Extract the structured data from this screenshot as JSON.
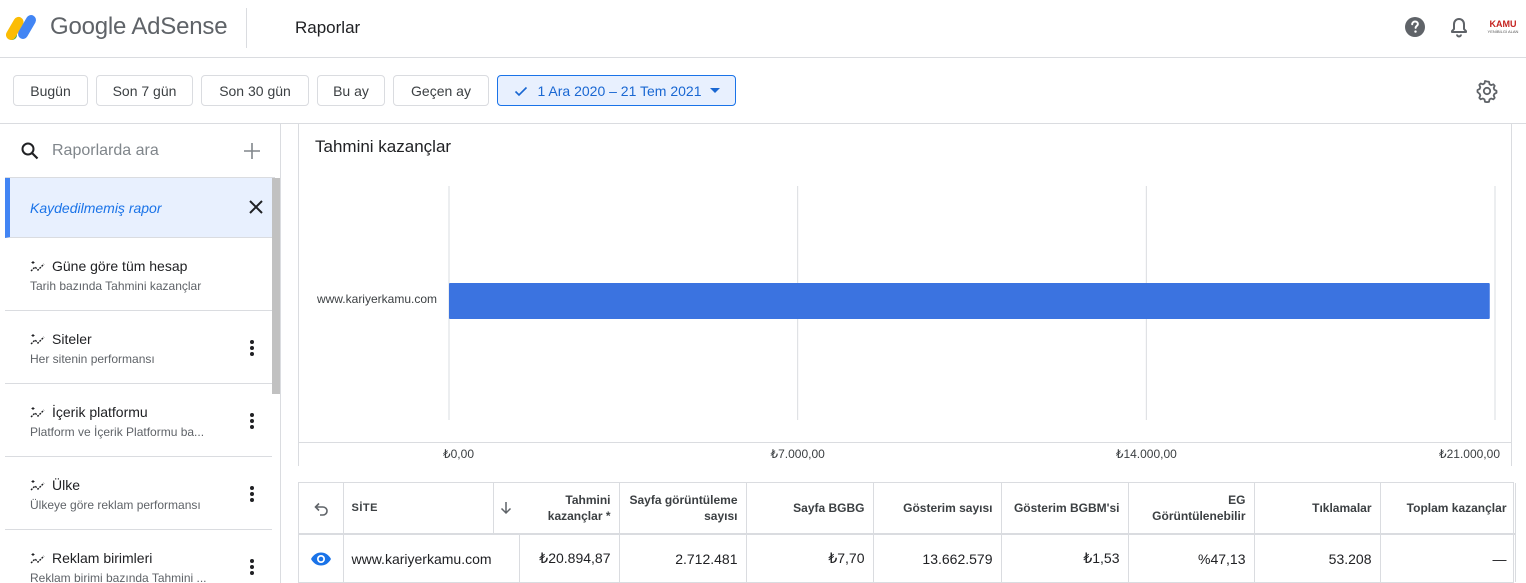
{
  "header": {
    "brand": "Google AdSense",
    "page_title": "Raporlar",
    "account_logo": "KAMU",
    "account_logo_sub": "YENİBİLGİ ALAN",
    "icons": [
      "help-icon",
      "bell-icon"
    ]
  },
  "date_filters": {
    "chips": [
      "Bugün",
      "Son 7 gün",
      "Son 30 gün",
      "Bu ay",
      "Geçen ay"
    ],
    "selected_range": "1 Ara 2020 – 21 Tem 2021",
    "icons": [
      "check-icon",
      "dropdown-arrow-icon",
      "settings-icon"
    ]
  },
  "sidebar": {
    "search_placeholder": "Raporlarda ara",
    "unsaved_report": "Kaydedilmemiş rapor",
    "reports": [
      {
        "title": "Güne göre tüm hesap",
        "subtitle": "Tarih bazında Tahmini kazançlar"
      },
      {
        "title": "Siteler",
        "subtitle": "Her sitenin performansı"
      },
      {
        "title": "İçerik platformu",
        "subtitle": "Platform ve İçerik Platformu ba..."
      },
      {
        "title": "Ülke",
        "subtitle": "Ülkeye göre reklam performansı"
      },
      {
        "title": "Reklam birimleri",
        "subtitle": "Reklam birimi bazında Tahmini ..."
      }
    ]
  },
  "chart": {
    "title": "Tahmini kazançlar"
  },
  "chart_data": {
    "type": "bar",
    "orientation": "horizontal",
    "title": "Tahmini kazançlar",
    "categories": [
      "www.kariyerkamu.com"
    ],
    "values": [
      20894.87
    ],
    "xlim": [
      0,
      21000
    ],
    "x_ticks": [
      0,
      7000,
      14000,
      21000
    ],
    "x_tick_labels": [
      "₺0,00",
      "₺7.000,00",
      "₺14.000,00",
      "₺21.000,00"
    ],
    "grid": true,
    "bar_color": "#3b73e0"
  },
  "table": {
    "headers": {
      "site": "SİTE",
      "earnings": "Tahmini kazançlar *",
      "pageviews": "Sayfa görüntüleme sayısı",
      "page_rpm": "Sayfa BGBG",
      "impressions": "Gösterim sayısı",
      "impression_rpm": "Gösterim BGBM'si",
      "active_view": "EG Görüntülenebilir",
      "clicks": "Tıklamalar",
      "total_earnings": "Toplam kazançlar"
    },
    "rows": [
      {
        "site": "www.kariyerkamu.com",
        "earnings": "₺20.894,87",
        "pageviews": "2.712.481",
        "page_rpm": "₺7,70",
        "impressions": "13.662.579",
        "impression_rpm": "₺1,53",
        "active_view": "%47,13",
        "clicks": "53.208",
        "total_earnings": "—"
      }
    ],
    "icons": [
      "undo-icon",
      "sort-arrow-icon",
      "eye-icon"
    ]
  }
}
